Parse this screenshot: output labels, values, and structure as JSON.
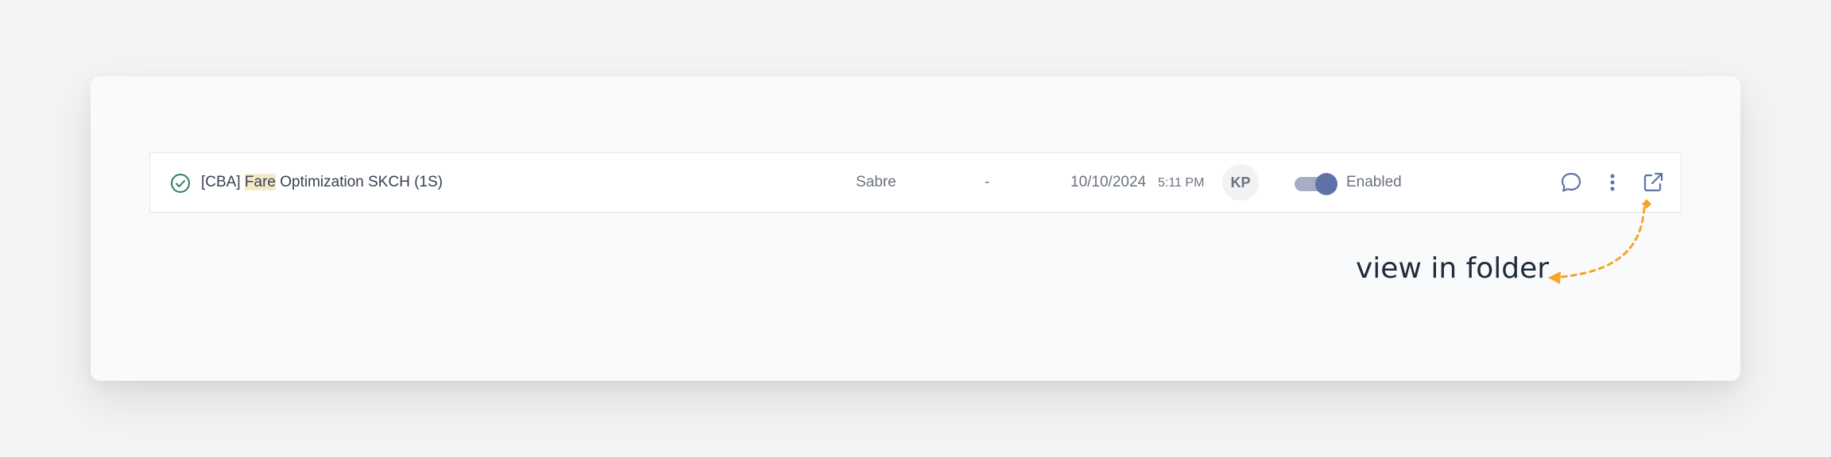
{
  "row": {
    "status_icon": "check-circle-icon",
    "title_prefix": "[CBA] ",
    "title_highlight": "Fare",
    "title_suffix": " Optimization SKCH (1S)",
    "source": "Sabre",
    "secondary": "-",
    "date": "10/10/2024",
    "time": "5:11 PM",
    "avatar_initials": "KP",
    "toggle_state": "on",
    "toggle_label": "Enabled",
    "actions": [
      "comment-icon",
      "more-vertical-icon",
      "external-link-icon"
    ]
  },
  "annotation": {
    "text": "view in folder",
    "color": "#f5a623"
  },
  "colors": {
    "accent": "#5f72a8",
    "success": "#2e7d5b",
    "highlight": "#f5e9c8"
  }
}
